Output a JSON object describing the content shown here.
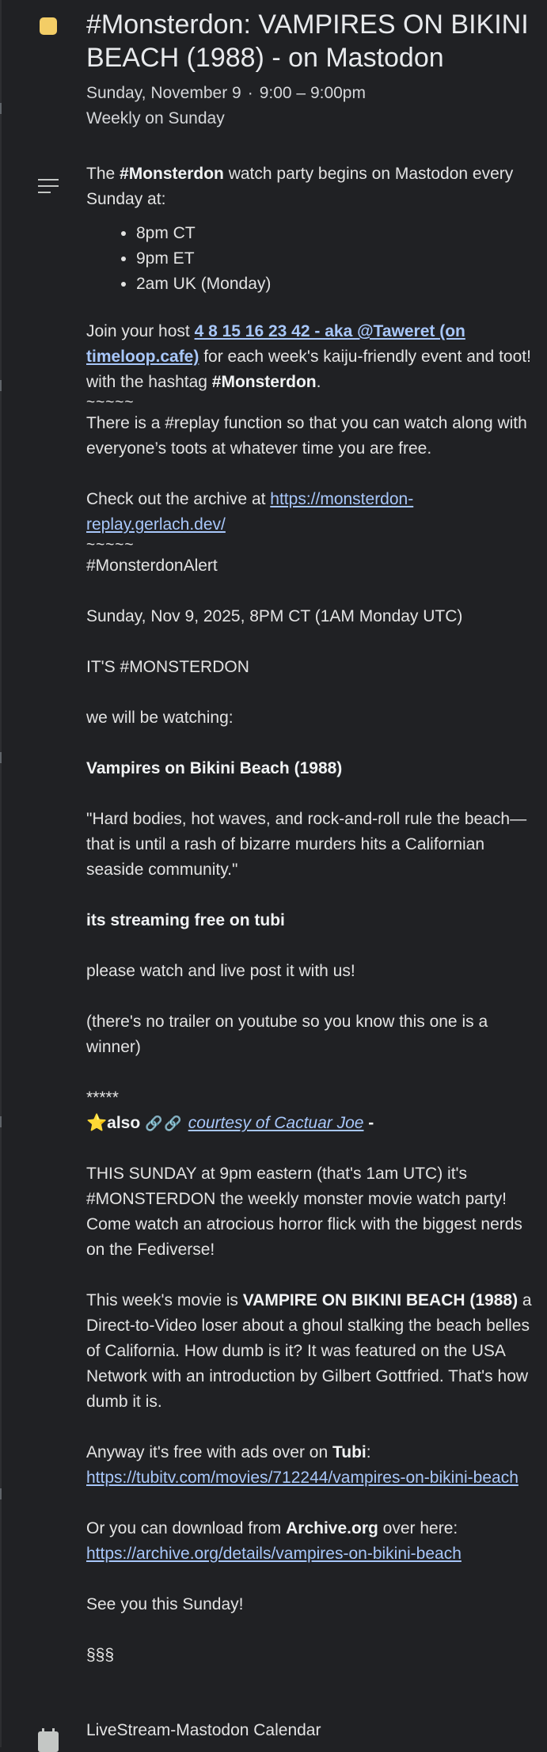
{
  "event": {
    "color": "#f3cd66",
    "title": "#Monsterdon: VAMPIRES ON BIKINI BEACH (1988) - on Mastodon",
    "date": "Sunday, November 9",
    "separator": "·",
    "time": "9:00 – 9:00pm",
    "recurrence": "Weekly on Sunday"
  },
  "description": {
    "intro_pre": "The ",
    "intro_bold": "#Monsterdon",
    "intro_post": " watch party begins on Mastodon every Sunday at:",
    "times": [
      "8pm CT",
      "9pm ET",
      "2am UK (Monday)"
    ],
    "host_pre": "Join your host ",
    "host_link": "4 8 15 16 23 42 - aka @Taweret (on timeloop.cafe)",
    "host_mid": " for each week's kaiju-friendly event and toot! with the hashtag ",
    "host_tag": "#Monsterdon",
    "host_end": ".",
    "tilde1": "~~~~~",
    "replay": "There is a #replay function so that you can watch along with everyone’s toots at whatever time you are free.",
    "archive_pre": "Check out the archive at ",
    "archive_link": "https://monsterdon-replay.gerlach.dev/",
    "tilde2": "~~~~~",
    "alert": "#MonsterdonAlert",
    "alert_date": "Sunday, Nov 9,  2025, 8PM CT (1AM Monday UTC)",
    "its": "IT'S #MONSTERDON",
    "watching": "we will be watching:",
    "movie": "Vampires on Bikini Beach (1988)",
    "tagline": "\"Hard bodies, hot waves, and rock-and-roll rule the beach—that is until a rash of bizarre murders hits a Californian seaside community.\"",
    "streaming": "its streaming free on tubi",
    "please": "please watch and live post it with us!",
    "trailer": "(there's no trailer on youtube so you know this one is a winner)",
    "stars": "*****",
    "star_emoji": "⭐",
    "also": "also ",
    "chains": "🔗🔗",
    "courtesy": "courtesy of Cactuar Joe",
    "courtesy_end": " -",
    "sunday": "THIS SUNDAY at 9pm eastern (that's 1am UTC) it's #MONSTERDON the weekly monster movie watch party! Come watch an atrocious horror flick with the biggest nerds on the Fediverse!",
    "week_pre": "This week's movie is ",
    "week_bold": "VAMPIRE ON BIKINI BEACH (1988)",
    "week_post": " a Direct-to-Video loser about a ghoul stalking the beach belles of California. How dumb is it? It was featured on the USA Network with an introduction by Gilbert Gottfried. That's how dumb it is.",
    "tubi_pre": "Anyway it's free with ads over on ",
    "tubi_bold": "Tubi",
    "tubi_colon": ":",
    "tubi_link": "https://tubitv.com/movies/712244/vampires-on-bikini-beach",
    "archive2_pre": "Or you can download from ",
    "archive2_bold": "Archive.org",
    "archive2_post": " over here:",
    "archive2_link": "https://archive.org/details/vampires-on-bikini-beach",
    "see_you": "See you this Sunday!",
    "section": "§§§"
  },
  "calendar": {
    "icon": "calendar-icon",
    "name": "LiveStream-Mastodon Calendar"
  }
}
